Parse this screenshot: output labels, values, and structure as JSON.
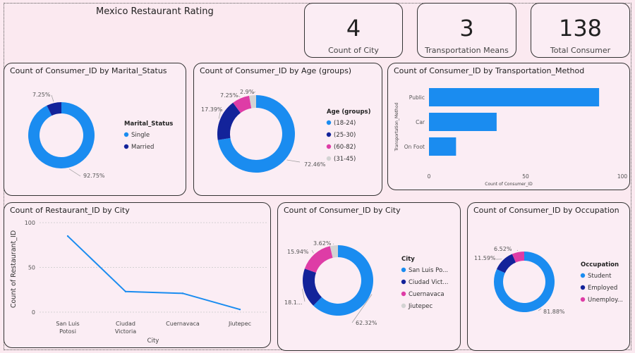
{
  "report_title": "Mexico Restaurant Rating",
  "kpis": [
    {
      "value": "4",
      "label": "Count of City"
    },
    {
      "value": "3",
      "label": "Transportation Means"
    },
    {
      "value": "138",
      "label": "Total Consumer"
    }
  ],
  "colors": {
    "blue": "#1a8cf0",
    "navy": "#13239a",
    "pink": "#de3ca6",
    "grey": "#d3d3d3"
  },
  "chart_data": [
    {
      "type": "pie",
      "title": "Count of Consumer_ID by Marital_Status",
      "legend_title": "Marital_Status",
      "legend_placement": "right",
      "slices": [
        {
          "label": "Single",
          "value": 92.75,
          "pct_label": "92.75%",
          "color": "#1a8cf0"
        },
        {
          "label": "Married",
          "value": 7.25,
          "pct_label": "7.25%",
          "color": "#13239a"
        }
      ]
    },
    {
      "type": "pie",
      "title": "Count of Consumer_ID by Age (groups)",
      "legend_title": "Age (groups)",
      "legend_placement": "right",
      "slices": [
        {
          "label": "(18-24)",
          "value": 72.46,
          "pct_label": "72.46%",
          "color": "#1a8cf0"
        },
        {
          "label": "(25-30)",
          "value": 17.39,
          "pct_label": "17.39%",
          "color": "#13239a"
        },
        {
          "label": "(60-82)",
          "value": 7.25,
          "pct_label": "7.25%",
          "color": "#de3ca6"
        },
        {
          "label": "(31-45)",
          "value": 2.9,
          "pct_label": "2.9%",
          "color": "#d3d3d3"
        }
      ]
    },
    {
      "type": "bar",
      "orientation": "horizontal",
      "title": "Count of Consumer_ID by Transportation_Method",
      "categories": [
        "Public",
        "Car",
        "On Foot"
      ],
      "values": [
        88,
        35,
        14
      ],
      "xlabel": "Count of Consumer_ID",
      "ylabel": "Transportation_Method",
      "xlim": [
        0,
        100
      ],
      "xticks": [
        "0",
        "50",
        "100"
      ],
      "color": "#1a8cf0"
    },
    {
      "type": "line",
      "title": "Count of Restaurant_ID by City",
      "categories": [
        "San Luis Potosi",
        "Ciudad Victoria",
        "Cuernavaca",
        "Jiutepec"
      ],
      "values": [
        85,
        23,
        21,
        3
      ],
      "xlabel": "City",
      "ylabel": "Count of Restaurant_ID",
      "ylim": [
        0,
        100
      ],
      "yticks": [
        "0",
        "50",
        "100"
      ],
      "grid": true,
      "color": "#1a8cf0"
    },
    {
      "type": "pie",
      "title": "Count of Consumer_ID by City",
      "legend_title": "City",
      "legend_placement": "right",
      "slices": [
        {
          "label": "San Luis Po...",
          "value": 62.32,
          "pct_label": "62.32%",
          "color": "#1a8cf0"
        },
        {
          "label": "Ciudad Vict...",
          "value": 18.12,
          "pct_label": "18.1...",
          "color": "#13239a"
        },
        {
          "label": "Cuernavaca",
          "value": 15.94,
          "pct_label": "15.94%",
          "color": "#de3ca6"
        },
        {
          "label": "Jiutepec",
          "value": 3.62,
          "pct_label": "3.62%",
          "color": "#d3d3d3"
        }
      ]
    },
    {
      "type": "pie",
      "title": "Count of Consumer_ID by Occupation",
      "legend_title": "Occupation",
      "legend_placement": "right",
      "slices": [
        {
          "label": "Student",
          "value": 81.88,
          "pct_label": "81.88%",
          "color": "#1a8cf0"
        },
        {
          "label": "Employed",
          "value": 11.59,
          "pct_label": "11.59%",
          "color": "#13239a"
        },
        {
          "label": "Unemploy...",
          "value": 6.52,
          "pct_label": "6.52%",
          "color": "#de3ca6"
        }
      ]
    }
  ]
}
